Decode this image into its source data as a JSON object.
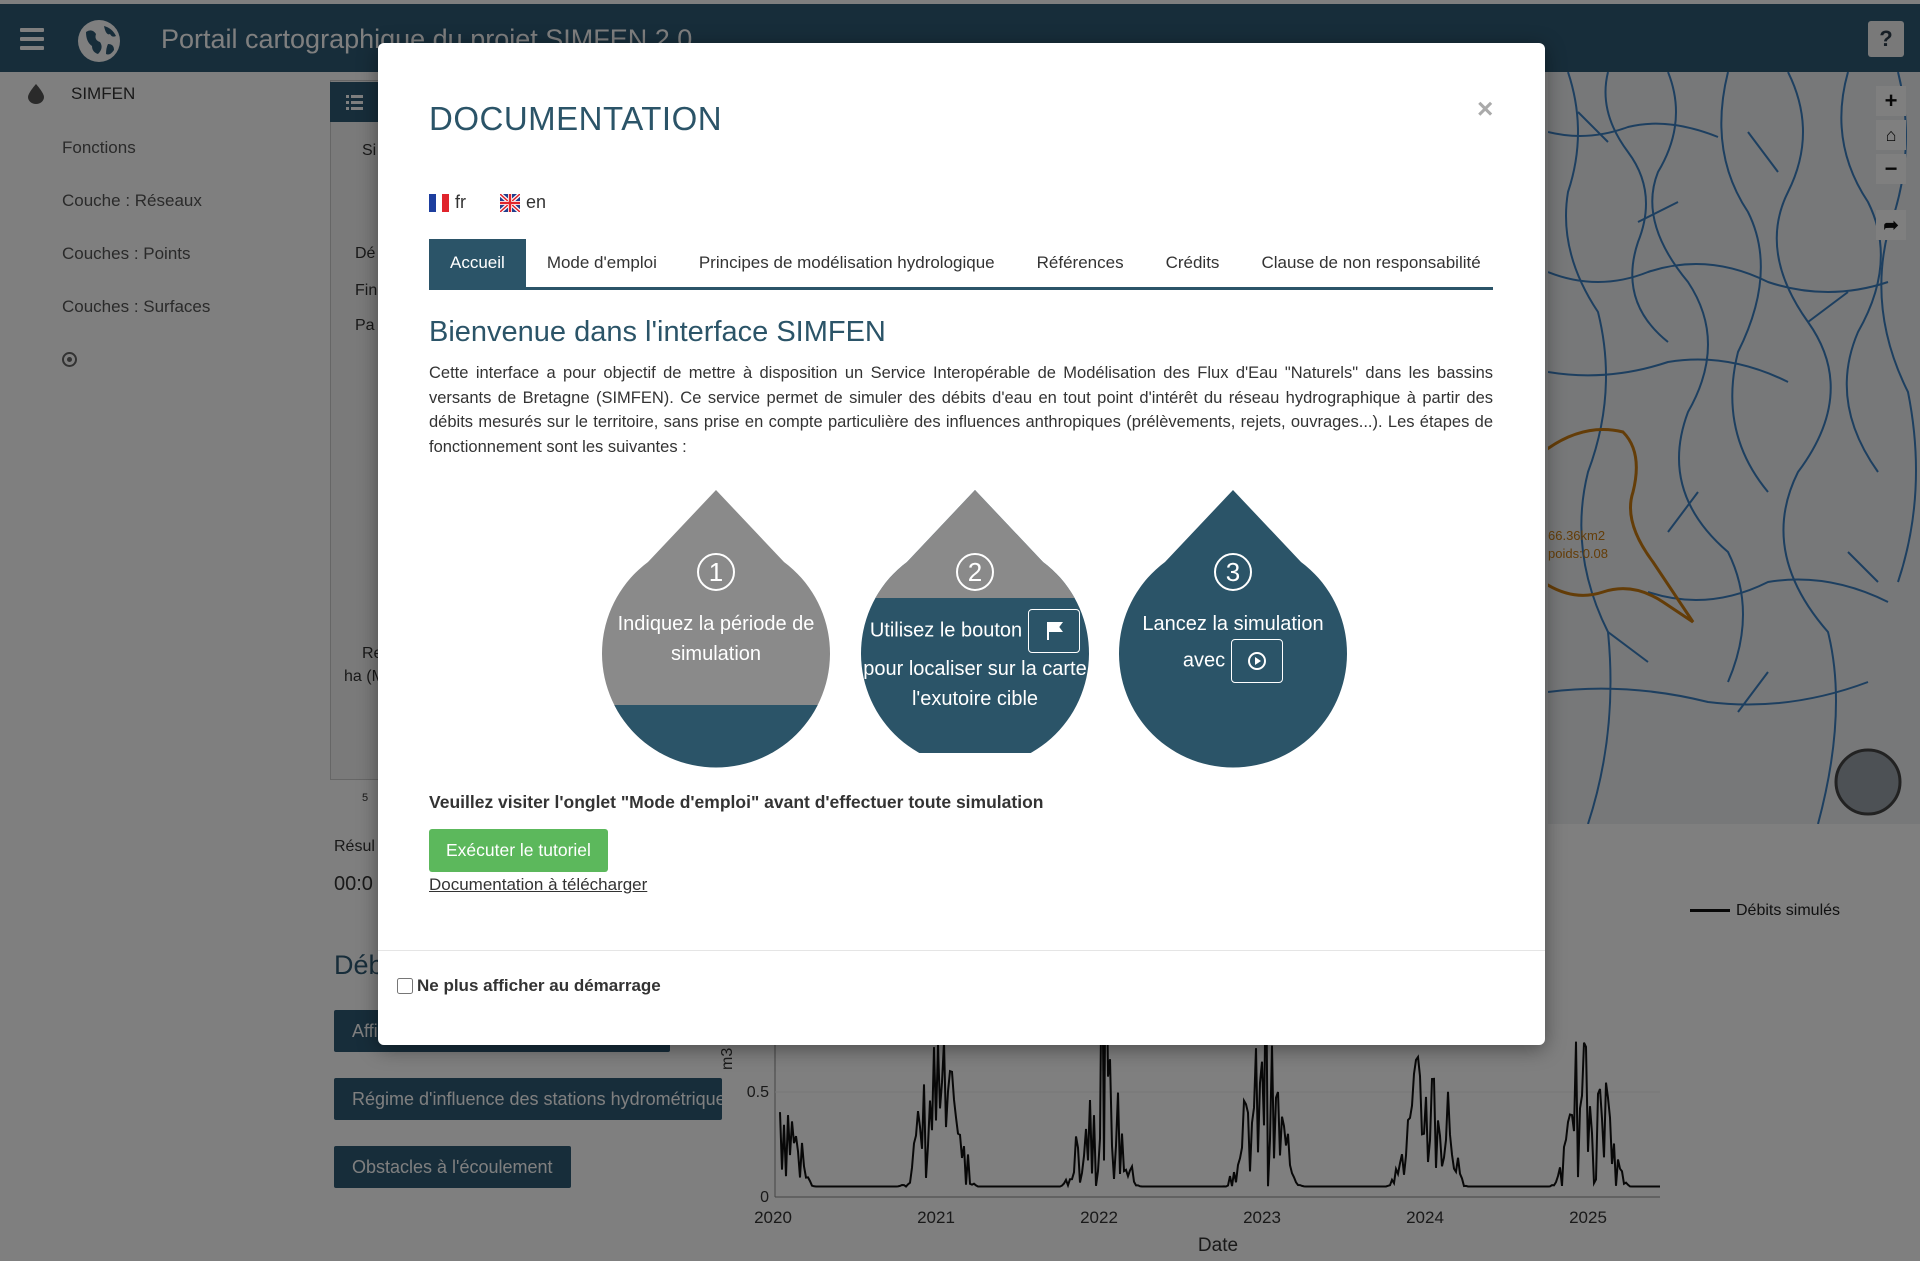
{
  "app": {
    "title": "Portail cartographique du projet SIMFEN 2.0",
    "help_label": "?"
  },
  "sidebar": {
    "header": "SIMFEN",
    "items": [
      "Fonctions",
      "Couche : Réseaux",
      "Couches : Points",
      "Couches : Surfaces"
    ]
  },
  "background": {
    "partial_texts": [
      "Si",
      "Dé",
      "Fin",
      "Pa",
      "Re",
      "ha (M",
      "Résul",
      "00:0",
      "5 "
    ],
    "heading": "Débi",
    "buttons": [
      "Affi",
      "Régime d'influence des stations hydrométriques",
      "Obstacles à l'écoulement"
    ],
    "map_labels": [
      "66.36km2",
      "poids:0.08"
    ]
  },
  "chart_data": {
    "type": "line",
    "x_ticks": [
      "2020",
      "2021",
      "2022",
      "2023",
      "2024",
      "2025"
    ],
    "y_ticks": [
      "0",
      "0.5"
    ],
    "xlabel": "Date",
    "ylabel": "m3",
    "series": [
      {
        "name": "Débits simulés"
      }
    ]
  },
  "modal": {
    "title": "DOCUMENTATION",
    "close_label": "×",
    "languages": [
      {
        "code": "fr"
      },
      {
        "code": "en"
      }
    ],
    "tabs": [
      "Accueil",
      "Mode d'emploi",
      "Principes de modélisation hydrologique",
      "Références",
      "Crédits",
      "Clause de non responsabilité"
    ],
    "active_tab": "Accueil",
    "welcome_title": "Bienvenue dans l'interface SIMFEN",
    "intro": "Cette interface a pour objectif de mettre à disposition un Service Interopérable de Modélisation des Flux d'Eau \"Naturels\" dans les bassins versants de Bretagne (SIMFEN). Ce service permet de simuler des débits d'eau en tout point d'intérêt du réseau hydrographique à partir des débits mesurés sur le territoire, sans prise en compte particulière des influences anthropiques (prélèvements, rejets, ouvrages...). Les étapes de fonctionnement sont les suivantes :",
    "steps": [
      {
        "number": "1",
        "text": "Indiquez la période de simulation"
      },
      {
        "number": "2",
        "text_before": "Utilisez le bouton",
        "text_after": "pour localiser sur la carte l'exutoire cible"
      },
      {
        "number": "3",
        "text_before": "Lancez la simulation",
        "text_after": "avec"
      }
    ],
    "warning": "Veuillez visiter l'onglet \"Mode d'emploi\" avant d'effectuer toute simulation",
    "tutorial_button": "Exécuter le tutoriel",
    "download_link": "Documentation à télécharger",
    "footer_checkbox": "Ne plus afficher au démarrage"
  },
  "colors": {
    "primary": "#2b5468",
    "drop_grey": "#8a8a8a",
    "success": "#5cb85c",
    "map_river": "#3a7fc0",
    "map_basin": "#c97a10"
  }
}
